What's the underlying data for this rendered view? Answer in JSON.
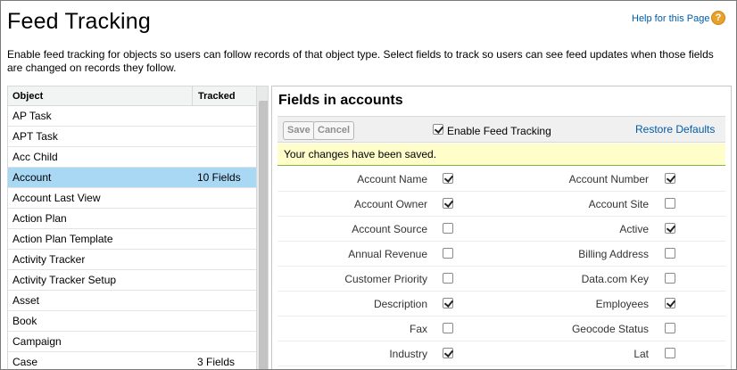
{
  "header": {
    "title": "Feed Tracking",
    "help_link": "Help for this Page",
    "help_icon": "question-mark-icon"
  },
  "intro": "Enable feed tracking for objects so users can follow records of that object type. Select fields to track so users can see feed updates when those fields are changed on records they follow.",
  "objects": {
    "columns": [
      "Object",
      "Tracked"
    ],
    "rows": [
      {
        "name": "AP Task",
        "tracked": ""
      },
      {
        "name": "APT Task",
        "tracked": ""
      },
      {
        "name": "Acc Child",
        "tracked": ""
      },
      {
        "name": "Account",
        "tracked": "10 Fields",
        "selected": true
      },
      {
        "name": "Account Last View",
        "tracked": ""
      },
      {
        "name": "Action Plan",
        "tracked": ""
      },
      {
        "name": "Action Plan Template",
        "tracked": ""
      },
      {
        "name": "Activity Tracker",
        "tracked": ""
      },
      {
        "name": "Activity Tracker Setup",
        "tracked": ""
      },
      {
        "name": "Asset",
        "tracked": ""
      },
      {
        "name": "Book",
        "tracked": ""
      },
      {
        "name": "Campaign",
        "tracked": ""
      },
      {
        "name": "Case",
        "tracked": "3 Fields"
      }
    ]
  },
  "fields_panel": {
    "title": "Fields in accounts",
    "save_label": "Save",
    "cancel_label": "Cancel",
    "enable_label": "Enable Feed Tracking",
    "enable_checked": true,
    "restore_label": "Restore Defaults",
    "saved_message": "Your changes have been saved.",
    "rows": [
      {
        "left": "Account Name",
        "left_checked": true,
        "right": "Account Number",
        "right_checked": true
      },
      {
        "left": "Account Owner",
        "left_checked": true,
        "right": "Account Site",
        "right_checked": false
      },
      {
        "left": "Account Source",
        "left_checked": false,
        "right": "Active",
        "right_checked": true
      },
      {
        "left": "Annual Revenue",
        "left_checked": false,
        "right": "Billing Address",
        "right_checked": false
      },
      {
        "left": "Customer Priority",
        "left_checked": false,
        "right": "Data.com Key",
        "right_checked": false
      },
      {
        "left": "Description",
        "left_checked": true,
        "right": "Employees",
        "right_checked": true
      },
      {
        "left": "Fax",
        "left_checked": false,
        "right": "Geocode Status",
        "right_checked": false
      },
      {
        "left": "Industry",
        "left_checked": true,
        "right": "Lat",
        "right_checked": false
      }
    ]
  },
  "colors": {
    "link": "#015ba7",
    "selected_row": "#a9d8f5",
    "saved_bg": "#fffecb",
    "saved_border": "#82b444"
  }
}
